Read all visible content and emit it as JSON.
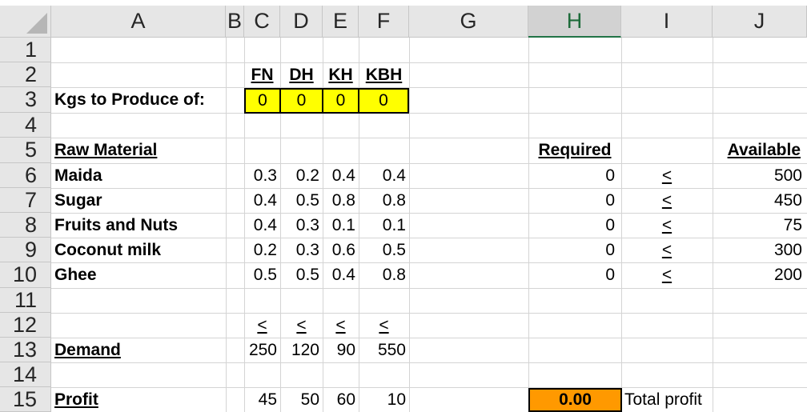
{
  "columns": [
    "A",
    "B",
    "C",
    "D",
    "E",
    "F",
    "G",
    "H",
    "I",
    "J"
  ],
  "rows": [
    "1",
    "2",
    "3",
    "4",
    "5",
    "6",
    "7",
    "8",
    "9",
    "10",
    "11",
    "12",
    "13",
    "14",
    "15"
  ],
  "selected_column": "H",
  "colors": {
    "input_fill": "#ffff00",
    "profit_fill": "#ff9900",
    "header_bg": "#e6e6e6",
    "selected_header": "#217346"
  },
  "products": [
    "FN",
    "DH",
    "KH",
    "KBH"
  ],
  "kgs_label": "Kgs to Produce of:",
  "kgs_values": [
    "0",
    "0",
    "0",
    "0"
  ],
  "raw_material_header": "Raw Material",
  "required_header": "Required",
  "available_header": "Available",
  "materials": [
    {
      "name": "Maida",
      "coef": [
        "0.3",
        "0.2",
        "0.4",
        "0.4"
      ],
      "required": "0",
      "op": "<",
      "available": "500"
    },
    {
      "name": "Sugar",
      "coef": [
        "0.4",
        "0.5",
        "0.8",
        "0.8"
      ],
      "required": "0",
      "op": "<",
      "available": "450"
    },
    {
      "name": "Fruits and Nuts",
      "coef": [
        "0.4",
        "0.3",
        "0.1",
        "0.1"
      ],
      "required": "0",
      "op": "<",
      "available": "75"
    },
    {
      "name": "Coconut milk",
      "coef": [
        "0.2",
        "0.3",
        "0.6",
        "0.5"
      ],
      "required": "0",
      "op": "<",
      "available": "300"
    },
    {
      "name": "Ghee",
      "coef": [
        "0.5",
        "0.5",
        "0.4",
        "0.8"
      ],
      "required": "0",
      "op": "<",
      "available": "200"
    }
  ],
  "demand_ops": [
    "<",
    "<",
    "<",
    "<"
  ],
  "demand_label": "Demand",
  "demand_values": [
    "250",
    "120",
    "90",
    "550"
  ],
  "profit_label": "Profit",
  "profit_values": [
    "45",
    "50",
    "60",
    "10"
  ],
  "total_profit_value": "0.00",
  "total_profit_label": "Total profit"
}
